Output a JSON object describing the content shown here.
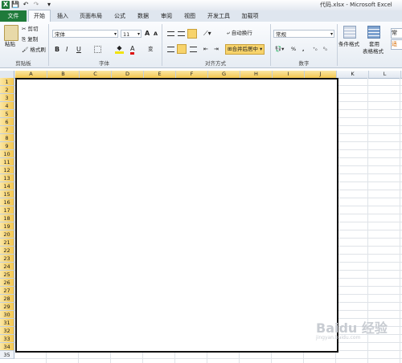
{
  "window": {
    "title": "代码.xlsx - Microsoft Excel",
    "app_logo": "X"
  },
  "quick_access": {
    "save": "💾",
    "undo": "↶",
    "redo": "↷",
    "customize": "▾"
  },
  "tabs": [
    {
      "label": "文件"
    },
    {
      "label": "开始"
    },
    {
      "label": "插入"
    },
    {
      "label": "页面布局"
    },
    {
      "label": "公式"
    },
    {
      "label": "数据"
    },
    {
      "label": "审阅"
    },
    {
      "label": "视图"
    },
    {
      "label": "开发工具"
    },
    {
      "label": "加载项"
    }
  ],
  "clipboard": {
    "paste": "粘贴",
    "cut": "剪切",
    "copy": "复制",
    "format_painter": "格式刷",
    "group": "剪贴板"
  },
  "font": {
    "name": "宋体",
    "size": "11",
    "bold": "B",
    "italic": "I",
    "underline": "U",
    "grow": "A",
    "shrink": "A",
    "color_a": "A",
    "wen": "变",
    "group": "字体"
  },
  "alignment": {
    "wrap": "自动换行",
    "merge_center": "合并后居中",
    "group": "对齐方式"
  },
  "number": {
    "format": "常规",
    "percent": "%",
    "comma": ",",
    "group": "数字"
  },
  "styles": {
    "conditional": "条件格式",
    "table_format_top": "套用",
    "table_format_bottom": "表格格式",
    "cell_style": "常",
    "suit": "适"
  },
  "columns": [
    "A",
    "B",
    "C",
    "D",
    "E",
    "F",
    "G",
    "H",
    "I",
    "J",
    "K",
    "L"
  ],
  "selected_columns": [
    "A",
    "B",
    "C",
    "D",
    "E",
    "F",
    "G",
    "H",
    "I",
    "J"
  ],
  "rows": [
    "1",
    "2",
    "3",
    "4",
    "5",
    "6",
    "7",
    "8",
    "9",
    "10",
    "11",
    "12",
    "13",
    "14",
    "15",
    "16",
    "17",
    "18",
    "19",
    "20",
    "21",
    "22",
    "23",
    "24",
    "25",
    "26",
    "27",
    "28",
    "29",
    "30",
    "31",
    "32",
    "33",
    "34",
    "35"
  ],
  "selected_rows_count": 34,
  "watermark": {
    "text": "Baidu 经验",
    "sub": "jingyan.baidu.com"
  },
  "colors": {
    "file_tab": "#1f7a3a",
    "selection_header": "#f3c64f",
    "merged_border": "#111111"
  }
}
